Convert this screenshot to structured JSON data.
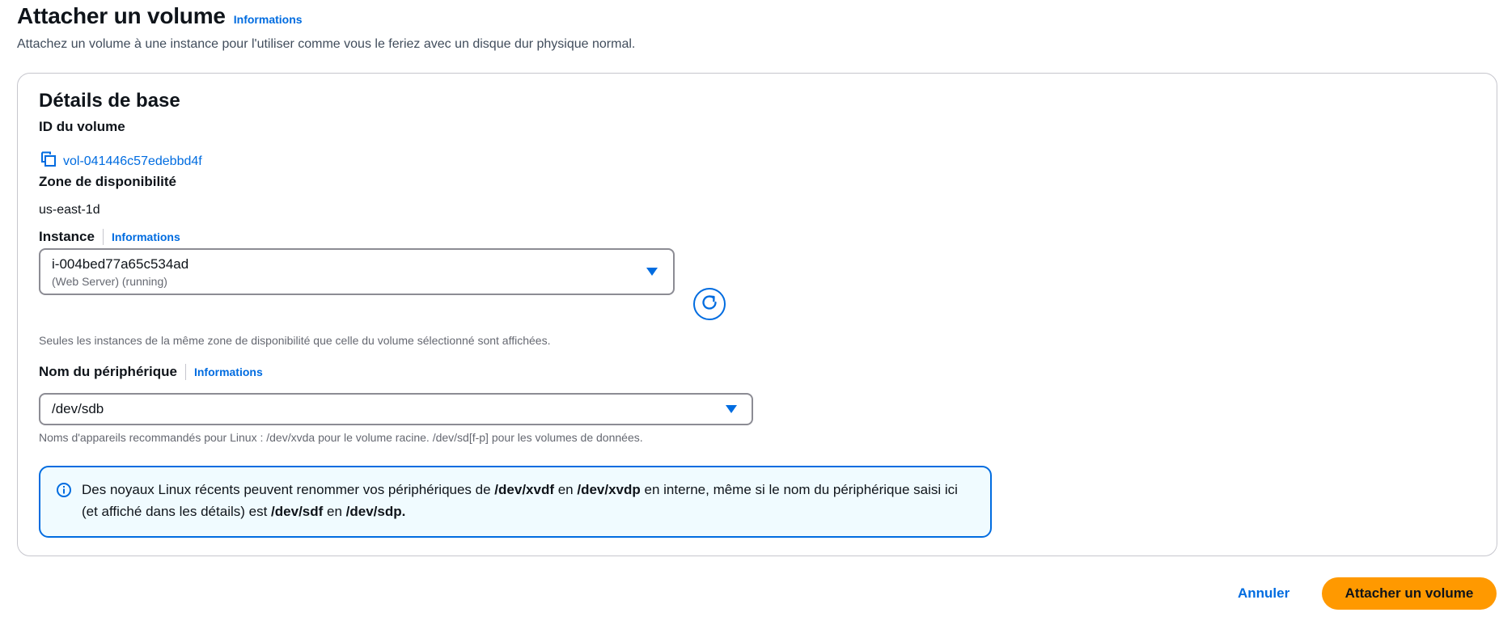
{
  "header": {
    "title": "Attacher un volume",
    "info_link": "Informations",
    "description": "Attachez un volume à une instance pour l'utiliser comme vous le feriez avec un disque dur physique normal."
  },
  "details": {
    "title": "Détails de base",
    "volume_id": {
      "label": "ID du volume",
      "value": "vol-041446c57edebbd4f",
      "icon": "copy-icon"
    },
    "availability_zone": {
      "label": "Zone de disponibilité",
      "value": "us-east-1d"
    },
    "instance": {
      "label": "Instance",
      "info_link": "Informations",
      "selected_value": "i-004bed77a65c534ad",
      "selected_description": "(Web Server) (running)",
      "help_text": "Seules les instances de la même zone de disponibilité que celle du volume sélectionné sont affichées.",
      "refresh_icon": "refresh-icon"
    },
    "device_name": {
      "label": "Nom du périphérique",
      "info_link": "Informations",
      "selected_value": "/dev/sdb",
      "help_text": "Noms d'appareils recommandés pour Linux : /dev/xvda pour le volume racine. /dev/sd[f-p] pour les volumes de données."
    },
    "alert": {
      "icon": "info-circle-icon",
      "part1": "Des noyaux Linux récents peuvent renommer vos périphériques de ",
      "bold1": "/dev/xvdf",
      "part2": " en ",
      "bold2": "/dev/xvdp",
      "part3": " en interne, même si le nom du périphérique saisi ici (et affiché dans les détails) est ",
      "bold3": "/dev/sdf",
      "part4": " en ",
      "bold4": "/dev/sdp."
    }
  },
  "footer": {
    "cancel_label": "Annuler",
    "submit_label": "Attacher un volume"
  },
  "colors": {
    "link": "#006ce0",
    "primary_button": "#ff9900",
    "alert_background": "#f0fbff",
    "border": "#c6c6cd"
  }
}
